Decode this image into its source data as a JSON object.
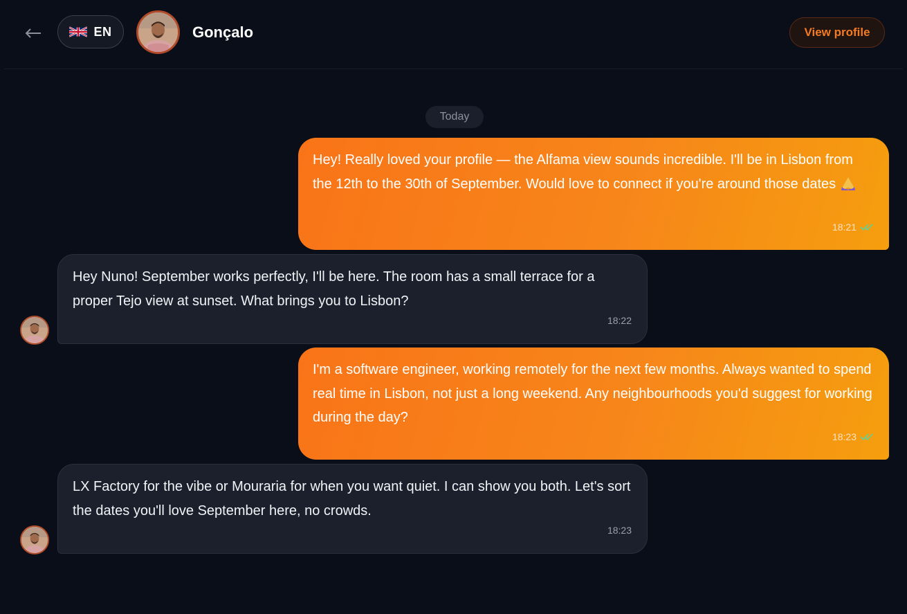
{
  "header": {
    "back_icon": "arrow-left-icon",
    "language": {
      "flag_icon": "uk-flag-icon",
      "label": "EN"
    },
    "contact": {
      "name": "Gonçalo",
      "avatar": "contact-avatar"
    },
    "view_profile_label": "View profile"
  },
  "colors": {
    "background": "#0a0e18",
    "accent": "#f57b22",
    "outgoing_bubble_start": "#f97418",
    "outgoing_bubble_end": "#f59e0e",
    "incoming_bubble": "#1b202c",
    "read_receipt": "#5dd39e"
  },
  "conversation": {
    "date_label": "Today",
    "messages": [
      {
        "direction": "outgoing",
        "text": "Hey! Really loved your profile — the Alfama view sounds incredible. I'll be in Lisbon from the 12th to the 30th of September. Would love to connect if you're around those dates",
        "emoji_icon": "folded-hands-icon",
        "time": "18:21",
        "status_icon": "double-check-icon"
      },
      {
        "direction": "incoming",
        "text": "Hey Nuno! September works perfectly, I'll be here. The room has a small terrace for a proper Tejo view at sunset. What brings you to Lisbon?",
        "time": "18:22"
      },
      {
        "direction": "outgoing",
        "text": "I'm a software engineer, working remotely for the next few months. Always wanted to spend real time in Lisbon, not just a long weekend. Any neighbourhoods you'd suggest for working during the day?",
        "time": "18:23",
        "status_icon": "double-check-icon"
      },
      {
        "direction": "incoming",
        "text": "LX Factory for the vibe or Mouraria for when you want quiet. I can show you both. Let's sort the dates you'll love September here, no crowds.",
        "time": "18:23"
      }
    ]
  }
}
